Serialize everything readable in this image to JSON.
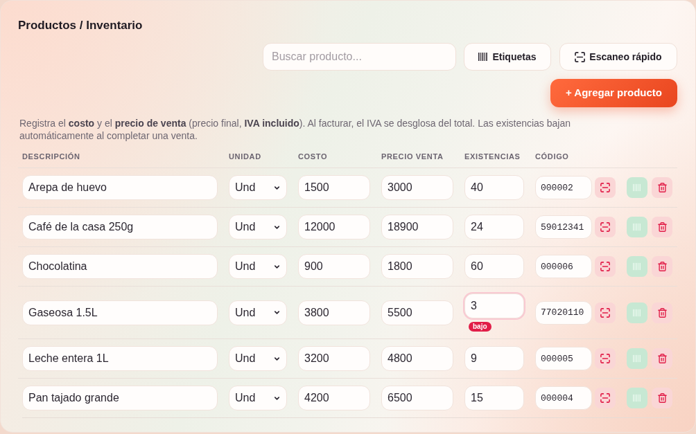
{
  "title": "Productos / Inventario",
  "toolbar": {
    "search": {
      "placeholder": "Buscar producto..."
    },
    "buttons": [
      {
        "kind": "labels",
        "label": "Etiquetas"
      },
      {
        "kind": "scan",
        "label": "Escaneo rápido"
      }
    ],
    "add_button": "+ Agregar producto"
  },
  "note": "Registra el **costo** y el **precio de venta** (precio final, **IVA incluido**). Al facturar, el IVA se desglosa del total. Las existencias bajan automáticamente al completar una venta.",
  "table": {
    "columns": [
      "DESCRIPCIÓN",
      "UNIDAD",
      "COSTO",
      "PRECIO VENTA",
      "EXISTENCIAS",
      "CÓDIGO"
    ],
    "rows": [
      {
        "description": "Arepa de huevo",
        "unit": "Und",
        "cost": "1500",
        "price": "3000",
        "stock": "40",
        "low_stock": false,
        "code": "000002"
      },
      {
        "description": "Café de la casa 250g",
        "unit": "Und",
        "cost": "12000",
        "price": "18900",
        "stock": "24",
        "low_stock": false,
        "code": "59012341"
      },
      {
        "description": "Chocolatina",
        "unit": "Und",
        "cost": "900",
        "price": "1800",
        "stock": "60",
        "low_stock": false,
        "code": "000006"
      },
      {
        "description": "Gaseosa 1.5L",
        "unit": "Und",
        "cost": "3800",
        "price": "5500",
        "stock": "3",
        "low_stock": true,
        "stock_badge": "bajo",
        "code": "77020110"
      },
      {
        "description": "Leche entera 1L",
        "unit": "Und",
        "cost": "3200",
        "price": "4800",
        "stock": "9",
        "low_stock": false,
        "code": "000005"
      },
      {
        "description": "Pan tajado grande",
        "unit": "Und",
        "cost": "4200",
        "price": "6500",
        "stock": "15",
        "low_stock": false,
        "code": "000004"
      }
    ]
  }
}
